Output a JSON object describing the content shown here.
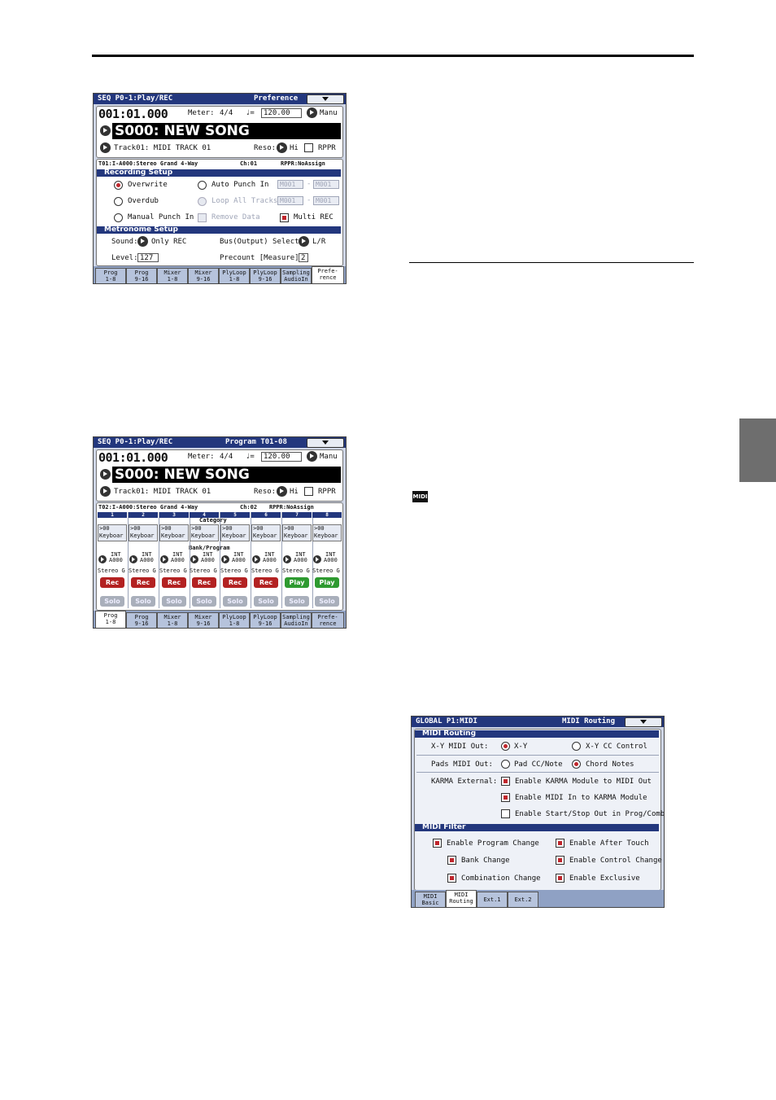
{
  "screen_preference": {
    "title": "SEQ P0-1:Play/REC",
    "page_label": "Preference",
    "position": "001:01.000",
    "meter_label": "Meter:",
    "meter": "4/4",
    "tempo_symbol": "♩=",
    "tempo": "120.00",
    "tempo_mode": "Manu",
    "song": "S000: NEW SONG",
    "track": "Track01: MIDI TRACK 01",
    "reso_label": "Reso:",
    "reso": "Hi",
    "rppr": "RPPR",
    "info_track": "T01:I-A000:Stereo Grand 4-Way",
    "info_ch": "Ch:01",
    "info_rppr": "RPPR:NoAssign",
    "recording_setup_title": "Recording Setup",
    "overwrite": "Overwrite",
    "overdub": "Overdub",
    "manual_punch": "Manual Punch In",
    "auto_punch": "Auto Punch In",
    "loop_all": "Loop All Tracks",
    "remove_data": "Remove Data",
    "multi_rec": "Multi REC",
    "m_from": "M001",
    "m_to": "M001",
    "m_dash": "-",
    "metronome_title": "Metronome Setup",
    "sound_label": "Sound:",
    "sound": "Only REC",
    "bus_label": "Bus(Output) Select:",
    "bus": "L/R",
    "level_label": "Level:",
    "level": "127",
    "precount_label": "Precount [Measure]:",
    "precount": "2"
  },
  "seq_tabs": [
    {
      "l1": "Prog",
      "l2": "1-8"
    },
    {
      "l1": "Prog",
      "l2": "9-16"
    },
    {
      "l1": "Mixer",
      "l2": "1-8"
    },
    {
      "l1": "Mixer",
      "l2": "9-16"
    },
    {
      "l1": "PlyLoop",
      "l2": "1-8"
    },
    {
      "l1": "PlyLoop",
      "l2": "9-16"
    },
    {
      "l1": "Sampling",
      "l2": "AudioIn"
    },
    {
      "l1": "Prefe-",
      "l2": "rence"
    }
  ],
  "screen_program": {
    "title": "SEQ P0-1:Play/REC",
    "page_label": "Program T01-08",
    "position": "001:01.000",
    "meter_label": "Meter:",
    "meter": "4/4",
    "tempo_symbol": "♩=",
    "tempo": "120.00",
    "tempo_mode": "Manu",
    "song": "S000: NEW SONG",
    "track": "Track01: MIDI TRACK 01",
    "reso_label": "Reso:",
    "reso": "Hi",
    "rppr": "RPPR",
    "info_track": "T02:I-A000:Stereo Grand 4-Way",
    "info_ch": "Ch:02",
    "info_rppr": "RPPR:NoAssign",
    "category_label": "Category",
    "bankprog_label": "Bank/Program",
    "channels": [
      {
        "num": "1",
        "cat_num": "00",
        "cat_name": "Keyboar",
        "bank": "INT",
        "prog": "A000",
        "name": "Stereo G",
        "mode": "Rec",
        "solo": "Solo"
      },
      {
        "num": "2",
        "cat_num": "00",
        "cat_name": "Keyboar",
        "bank": "INT",
        "prog": "A000",
        "name": "Stereo G",
        "mode": "Rec",
        "solo": "Solo"
      },
      {
        "num": "3",
        "cat_num": "00",
        "cat_name": "Keyboar",
        "bank": "INT",
        "prog": "A000",
        "name": "Stereo G",
        "mode": "Rec",
        "solo": "Solo"
      },
      {
        "num": "4",
        "cat_num": "00",
        "cat_name": "Keyboar",
        "bank": "INT",
        "prog": "A000",
        "name": "Stereo G",
        "mode": "Rec",
        "solo": "Solo"
      },
      {
        "num": "5",
        "cat_num": "00",
        "cat_name": "Keyboar",
        "bank": "INT",
        "prog": "A000",
        "name": "Stereo G",
        "mode": "Rec",
        "solo": "Solo"
      },
      {
        "num": "6",
        "cat_num": "00",
        "cat_name": "Keyboar",
        "bank": "INT",
        "prog": "A000",
        "name": "Stereo G",
        "mode": "Rec",
        "solo": "Solo"
      },
      {
        "num": "7",
        "cat_num": "00",
        "cat_name": "Keyboar",
        "bank": "INT",
        "prog": "A000",
        "name": "Stereo G",
        "mode": "Play",
        "solo": "Solo"
      },
      {
        "num": "8",
        "cat_num": "00",
        "cat_name": "Keyboar",
        "bank": "INT",
        "prog": "A000",
        "name": "Stereo G",
        "mode": "Play",
        "solo": "Solo"
      }
    ]
  },
  "midi_badge": "MIDI",
  "screen_global": {
    "title": "GLOBAL P1:MIDI",
    "page_label": "MIDI Routing",
    "routing_title": "MIDI Routing",
    "xy_label": "X-Y MIDI Out:",
    "xy_opt1": "X-Y",
    "xy_opt2": "X-Y CC Control",
    "pads_label": "Pads MIDI Out:",
    "pads_opt1": "Pad CC/Note",
    "pads_opt2": "Chord Notes",
    "karma_label": "KARMA External:",
    "karma_opt1": "Enable KARMA Module to MIDI Out",
    "karma_opt2": "Enable MIDI In to KARMA Module",
    "karma_opt3": "Enable Start/Stop Out in Prog/Combi",
    "filter_title": "MIDI Filter",
    "f_prog": "Enable Program Change",
    "f_bank": "Bank Change",
    "f_combo": "Combination Change",
    "f_after": "Enable After Touch",
    "f_control": "Enable Control Change",
    "f_excl": "Enable Exclusive",
    "tabs": [
      {
        "l1": "MIDI",
        "l2": "Basic"
      },
      {
        "l1": "MIDI",
        "l2": "Routing"
      },
      {
        "l1": "Ext.1",
        "l2": ""
      },
      {
        "l1": "Ext.2",
        "l2": ""
      }
    ]
  }
}
